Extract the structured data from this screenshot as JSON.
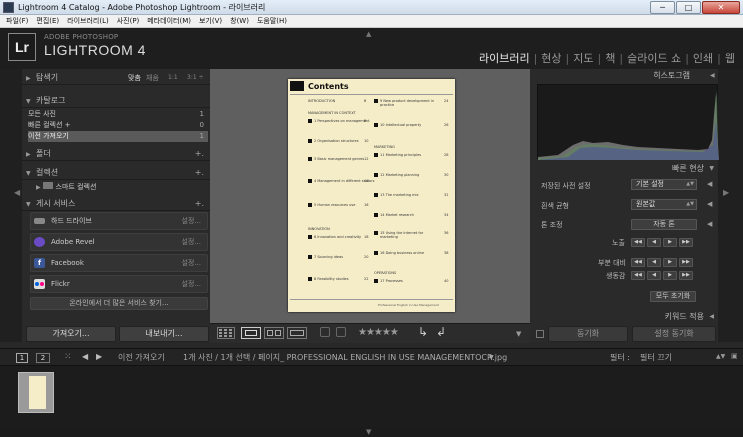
{
  "window": {
    "title": "Lightroom 4 Catalog - Adobe Photoshop Lightroom - 라이브러리",
    "minimize": "─",
    "maximize": "□",
    "close": "✕"
  },
  "menu": [
    "파일(F)",
    "편집(E)",
    "라이브러리(L)",
    "사진(P)",
    "메타데이터(M)",
    "보기(V)",
    "창(W)",
    "도움말(H)"
  ],
  "brand": {
    "logo": "Lr",
    "line1": "ADOBE PHOTOSHOP",
    "line2": "LIGHTROOM 4"
  },
  "modules": [
    {
      "label": "라이브러리",
      "active": true
    },
    {
      "label": "현상",
      "active": false
    },
    {
      "label": "지도",
      "active": false
    },
    {
      "label": "책",
      "active": false
    },
    {
      "label": "슬라이드 쇼",
      "active": false
    },
    {
      "label": "인쇄",
      "active": false
    },
    {
      "label": "웹",
      "active": false
    }
  ],
  "left": {
    "navigator": {
      "title": "탐색기",
      "fit": "맞춤",
      "fill": "채움",
      "r1": "1:1",
      "r3": "3:1 ÷"
    },
    "catalog": {
      "title": "카탈로그",
      "items": [
        {
          "label": "모든 사진",
          "count": "1"
        },
        {
          "label": "빠른 컬렉션 +",
          "count": "0"
        },
        {
          "label": "이전 가져오기",
          "count": "1"
        }
      ]
    },
    "folders": {
      "title": "폴더"
    },
    "collections": {
      "title": "컬렉션",
      "smart": "스마트 컬렉션"
    },
    "publish": {
      "title": "게시 서비스",
      "services": [
        {
          "label": "하드 드라이브",
          "status": "설정...",
          "icon": "hard-drive-icon",
          "color": "#888888"
        },
        {
          "label": "Adobe Revel",
          "status": "설정...",
          "icon": "revel-icon",
          "color": "#6a4bc4"
        },
        {
          "label": "Facebook",
          "status": "설정...",
          "icon": "facebook-icon",
          "color": "#3b5998"
        },
        {
          "label": "Flickr",
          "status": "설정...",
          "icon": "flickr-icon",
          "color": "#ff0084"
        }
      ],
      "find_more": "온라인에서 더 많은 서비스 찾기..."
    },
    "import_btn": "가져오기...",
    "export_btn": "내보내기..."
  },
  "document": {
    "title": "Contents",
    "col1": [
      {
        "t": "INTRODUCTION",
        "n": "6"
      },
      {
        "t": "MANAGEMENT IN CONTEXT",
        "n": ""
      },
      {
        "t": "1  Perspectives on management",
        "n": "8"
      },
      {
        "t": "2  Organisation structures",
        "n": "10"
      },
      {
        "t": "3  Basic management genres",
        "n": "12"
      },
      {
        "t": "4  Management in different sectors",
        "n": "14"
      },
      {
        "t": "5  Human resources use",
        "n": "16"
      },
      {
        "t": "INNOVATION",
        "n": ""
      },
      {
        "t": "6  Innovation and creativity",
        "n": "18"
      },
      {
        "t": "7  Sourcing ideas",
        "n": "20"
      },
      {
        "t": "8  Feasibility studies",
        "n": "22"
      }
    ],
    "col2": [
      {
        "t": "9  New product development in practice",
        "n": "24"
      },
      {
        "t": "10  Intellectual property",
        "n": "26"
      },
      {
        "t": "MARKETING",
        "n": ""
      },
      {
        "t": "11  Marketing principles",
        "n": "28"
      },
      {
        "t": "12  Marketing planning",
        "n": "30"
      },
      {
        "t": "13  The marketing mix",
        "n": "32"
      },
      {
        "t": "14  Market research",
        "n": "34"
      },
      {
        "t": "15  Using the Internet for marketing",
        "n": "36"
      },
      {
        "t": "16  Doing business online",
        "n": "38"
      },
      {
        "t": "OPERATIONS",
        "n": ""
      },
      {
        "t": "17  Processes",
        "n": "40"
      }
    ],
    "footer": "Professional English in Use Management"
  },
  "toolbar": {
    "stars": "★★★★★"
  },
  "right": {
    "histogram": "히스토그램",
    "quick_develop": "빠른 현상",
    "saved_preset_label": "저장된 사전 설정",
    "saved_preset_value": "기본 설정",
    "white_balance_label": "흰색 균형",
    "white_balance_value": "원본값",
    "tone_label": "톤 조정",
    "auto_tone": "자동 톤",
    "exposure": "노출",
    "clarity": "부분 대비",
    "vibrance": "생동감",
    "reset_all": "모두 초기화",
    "keywording": "키워드 적용",
    "sync": "동기화",
    "sync_settings": "설정 동기화"
  },
  "filmbar": {
    "page1": "1",
    "page2": "2",
    "source": "이전 가져오기",
    "info": "1개 사진 / 1개 선택 / 페이지_ PROFESSIONAL ENGLISH IN USE MANAGEMENTOCR.jpg",
    "filter_label": "필터 :",
    "filter_value": "필터 끄기"
  }
}
